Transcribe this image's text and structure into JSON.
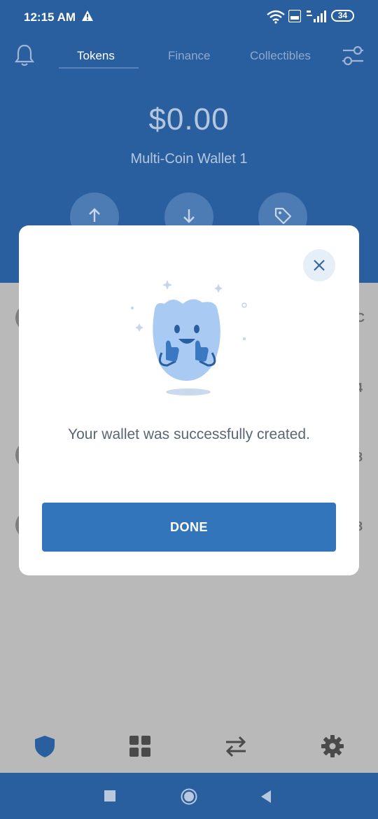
{
  "status": {
    "time": "12:15 AM",
    "battery": "34"
  },
  "header": {
    "tabs": [
      {
        "label": "Tokens",
        "active": true
      },
      {
        "label": "Finance",
        "active": false
      },
      {
        "label": "Collectibles",
        "active": false
      }
    ]
  },
  "wallet": {
    "balance": "$0.00",
    "name": "Multi-Coin Wallet 1"
  },
  "background_list": {
    "edge_chars": [
      "C",
      "4",
      "8",
      "8"
    ]
  },
  "modal": {
    "message": "Your wallet was successfully created.",
    "done_label": "DONE"
  },
  "colors": {
    "header_bg": "#2a5f9f",
    "accent": "#3375bb",
    "overlay": "#b9b9b9"
  },
  "icons": [
    "bell-icon",
    "settings-sliders-icon",
    "send-arrow-icon",
    "receive-arrow-icon",
    "tag-icon",
    "close-icon",
    "shield-icon",
    "grid-icon",
    "swap-icon",
    "gear-icon"
  ]
}
